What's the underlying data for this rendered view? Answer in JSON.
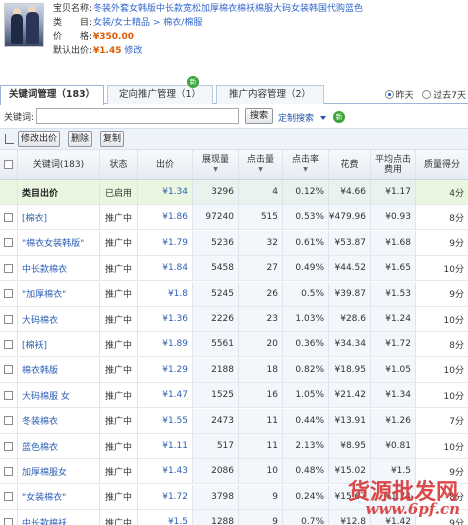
{
  "product": {
    "name_label": "宝贝名称:",
    "name": "冬装外套女韩版中长款宽松加厚棉衣棉袄棉服大码女装韩国代购蓝色",
    "category_label": "类　　目:",
    "category": "女装/女士精品 > 棉衣/棉服",
    "price_label": "价　　格:",
    "price": "¥350.00",
    "default_bid_label": "默认出价:",
    "default_bid": "¥1.45",
    "modify": "修改"
  },
  "tabs": [
    {
      "label": "关键词管理（183）",
      "active": true
    },
    {
      "label": "定向推广管理（1）",
      "active": false,
      "badge": "新"
    },
    {
      "label": "推广内容管理（2）",
      "active": false
    }
  ],
  "range": {
    "yesterday": "昨天",
    "past7": "过去7天",
    "selected": "yesterday"
  },
  "search": {
    "label": "关键词:",
    "value": "",
    "button": "搜索",
    "custom": "定制搜索",
    "badge": "新"
  },
  "toolbar": {
    "modify_bid": "修改出价",
    "delete": "删除",
    "copy": "复制"
  },
  "table": {
    "headers": {
      "keyword": "关键词(183)",
      "status": "状态",
      "bid": "出价",
      "impressions": "展现量",
      "clicks": "点击量",
      "ctr": "点击率",
      "cost": "花费",
      "avg_cpc_1": "平均点击",
      "avg_cpc_2": "费用",
      "qs": "质量得分"
    },
    "category_row": {
      "keyword": "类目出价",
      "status": "已启用",
      "bid": "¥1.34",
      "impressions": "3296",
      "clicks": "4",
      "ctr": "0.12%",
      "cost": "¥4.66",
      "avg_cpc": "¥1.17",
      "qs": "4分"
    },
    "rows": [
      {
        "keyword": "[棉衣]",
        "status": "推广中",
        "bid": "¥1.86",
        "impressions": "97240",
        "clicks": "515",
        "ctr": "0.53%",
        "cost": "¥479.96",
        "avg_cpc": "¥0.93",
        "qs": "8分"
      },
      {
        "keyword": "\"棉衣女装韩版\"",
        "status": "推广中",
        "bid": "¥1.79",
        "impressions": "5236",
        "clicks": "32",
        "ctr": "0.61%",
        "cost": "¥53.87",
        "avg_cpc": "¥1.68",
        "qs": "9分"
      },
      {
        "keyword": "中长款棉衣",
        "status": "推广中",
        "bid": "¥1.84",
        "impressions": "5458",
        "clicks": "27",
        "ctr": "0.49%",
        "cost": "¥44.52",
        "avg_cpc": "¥1.65",
        "qs": "10分"
      },
      {
        "keyword": "\"加厚棉衣\"",
        "status": "推广中",
        "bid": "¥1.8",
        "impressions": "5245",
        "clicks": "26",
        "ctr": "0.5%",
        "cost": "¥39.87",
        "avg_cpc": "¥1.53",
        "qs": "9分"
      },
      {
        "keyword": "大码棉衣",
        "status": "推广中",
        "bid": "¥1.36",
        "impressions": "2226",
        "clicks": "23",
        "ctr": "1.03%",
        "cost": "¥28.6",
        "avg_cpc": "¥1.24",
        "qs": "10分"
      },
      {
        "keyword": "[棉袄]",
        "status": "推广中",
        "bid": "¥1.89",
        "impressions": "5561",
        "clicks": "20",
        "ctr": "0.36%",
        "cost": "¥34.34",
        "avg_cpc": "¥1.72",
        "qs": "8分"
      },
      {
        "keyword": "棉衣韩版",
        "status": "推广中",
        "bid": "¥1.29",
        "impressions": "2188",
        "clicks": "18",
        "ctr": "0.82%",
        "cost": "¥18.95",
        "avg_cpc": "¥1.05",
        "qs": "10分"
      },
      {
        "keyword": "大码棉服 女",
        "status": "推广中",
        "bid": "¥1.47",
        "impressions": "1525",
        "clicks": "16",
        "ctr": "1.05%",
        "cost": "¥21.42",
        "avg_cpc": "¥1.34",
        "qs": "10分"
      },
      {
        "keyword": "冬装棉衣",
        "status": "推广中",
        "bid": "¥1.55",
        "impressions": "2473",
        "clicks": "11",
        "ctr": "0.44%",
        "cost": "¥13.91",
        "avg_cpc": "¥1.26",
        "qs": "7分"
      },
      {
        "keyword": "蓝色棉衣",
        "status": "推广中",
        "bid": "¥1.11",
        "impressions": "517",
        "clicks": "11",
        "ctr": "2.13%",
        "cost": "¥8.95",
        "avg_cpc": "¥0.81",
        "qs": "10分"
      },
      {
        "keyword": "加厚棉服女",
        "status": "推广中",
        "bid": "¥1.43",
        "impressions": "2086",
        "clicks": "10",
        "ctr": "0.48%",
        "cost": "¥15.02",
        "avg_cpc": "¥1.5",
        "qs": "9分"
      },
      {
        "keyword": "\"女装棉衣\"",
        "status": "推广中",
        "bid": "¥1.72",
        "impressions": "3798",
        "clicks": "9",
        "ctr": "0.24%",
        "cost": "¥15.67",
        "avg_cpc": "¥1.74",
        "qs": "8分"
      },
      {
        "keyword": "中长款棉袄",
        "status": "推广中",
        "bid": "¥1.5",
        "impressions": "1288",
        "clicks": "9",
        "ctr": "0.7%",
        "cost": "¥12.8",
        "avg_cpc": "¥1.42",
        "qs": "9分"
      }
    ]
  },
  "watermark": {
    "cn": "货源批发网",
    "url": "www.6pf.cn"
  },
  "colors": {
    "link": "#2d5fb4",
    "price": "#e05a00",
    "category_row": "#eaf6df",
    "badge": "#3aa33a"
  }
}
